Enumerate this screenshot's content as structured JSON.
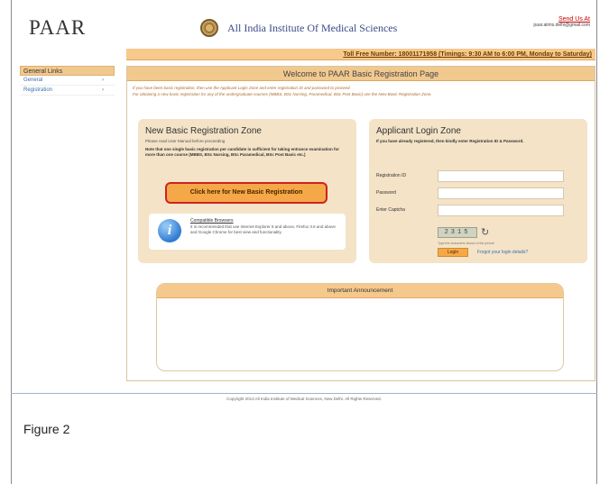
{
  "header": {
    "logo": "PAAR",
    "institute": "All India Institute Of Medical Sciences",
    "send_us": "Send Us At",
    "email": "paar.aiims.delhi@gmail.com"
  },
  "tollbar": {
    "text": "Toll Free Number: 18001171958 (Timings: 9:30 AM to 6:00 PM, Monday to Saturday)"
  },
  "sidebar": {
    "head": "General Links",
    "items": [
      {
        "label": "General"
      },
      {
        "label": "Registration"
      }
    ]
  },
  "main": {
    "welcome": "Welcome to PAAR Basic Registration Page",
    "info1": "If you have been basic registration, then use the Applicant Login Zone and enter registration ID and password to proceed.",
    "info2": "For obtaining a new basic registration for any of the undergraduate courses (MBBS, BSc Nursing, Paramedical, BSc Post Basic) use the New Basic Registration Zone."
  },
  "new_zone": {
    "title": "New Basic Registration Zone",
    "text1": "Please read User Manual before proceeding",
    "text2": "Note that one single basic registration per candidate is sufficient for taking entrance examination for more than one course (MBBS, BSc Nursing, BSc Paramedical, BSc Post Basic etc.)",
    "button": "Click here for New Basic Registration",
    "compat_title": "Compatible Browsers",
    "compat_text": "It is recommended that use Internet Explorer 8 and above, Firefox 3.6 and above and Google Chrome for best view and functionality."
  },
  "login_zone": {
    "title": "Applicant Login Zone",
    "text": "If you have already registered, then kindly enter Registration ID & Password.",
    "reg_label": "Registration ID",
    "pwd_label": "Password",
    "captcha_label": "Enter Captcha",
    "captcha": "2315",
    "captcha_note": "Type the characters shown in the picture",
    "login_button": "Login",
    "forgot": "Forgot your login details?"
  },
  "announcement": {
    "title": "Important Announcement"
  },
  "footer": {
    "copyright": "Copyright 2013 All India Institute of Medical Sciences, New Delhi. All Rights Reserved."
  },
  "caption": "Figure 2"
}
